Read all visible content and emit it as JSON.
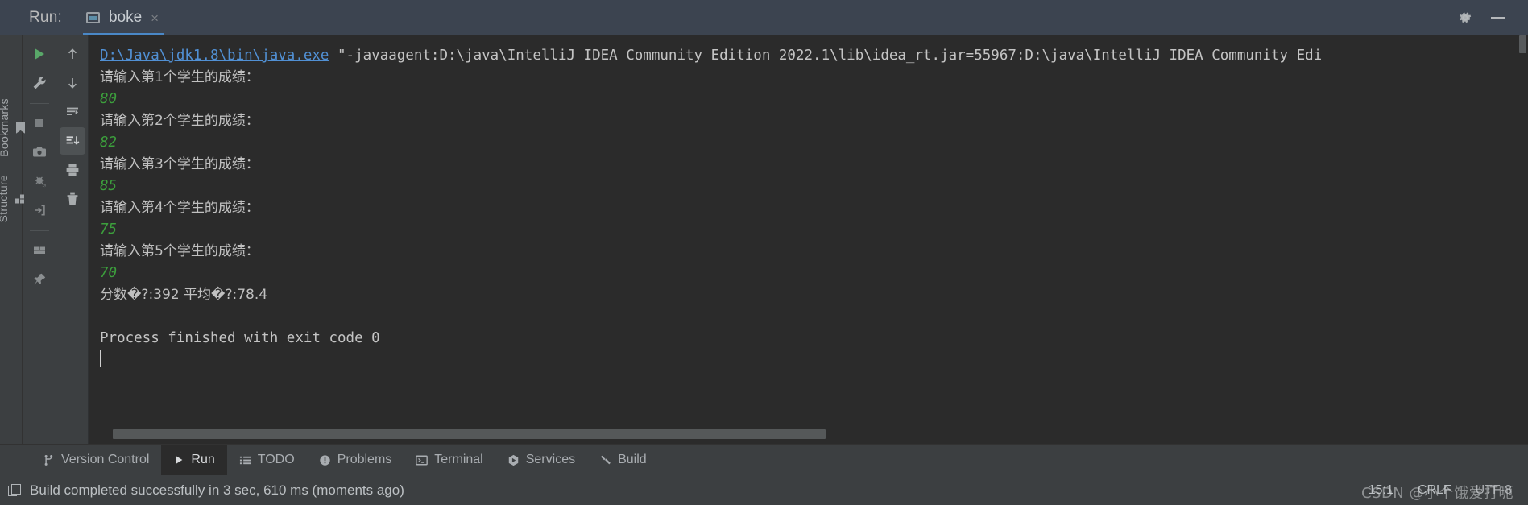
{
  "header": {
    "run_label": "Run:",
    "tab": {
      "title": "boke",
      "close": "×",
      "icon": "run-config-icon"
    },
    "settings_icon": "gear-icon",
    "minimize_icon": "minimize-icon"
  },
  "left_strip": {
    "items": [
      {
        "label": "Bookmarks",
        "icon": "bookmark-icon"
      },
      {
        "label": "Structure",
        "icon": "structure-icon"
      }
    ]
  },
  "run_toolbar": {
    "column_a": [
      {
        "name": "rerun-button",
        "icon": "play-icon",
        "tooltip": "Rerun"
      },
      {
        "name": "modify-run-configuration-button",
        "icon": "wrench-icon",
        "tooltip": "Modify Run Configuration"
      },
      {
        "name": "stop-button",
        "icon": "stop-icon",
        "tooltip": "Stop"
      },
      {
        "name": "screenshot-button",
        "icon": "camera-icon",
        "tooltip": "Take Screenshot"
      },
      {
        "name": "dump-threads-button",
        "icon": "bug-export-icon",
        "tooltip": "Dump Threads"
      },
      {
        "name": "restore-layout-button",
        "icon": "export-icon",
        "tooltip": "Restore Layout"
      },
      {
        "name": "layout-settings-button",
        "icon": "layout-icon",
        "tooltip": "Layout Settings"
      },
      {
        "name": "pin-tab-button",
        "icon": "pin-icon",
        "tooltip": "Pin Tab"
      }
    ],
    "column_b": [
      {
        "name": "up-the-stack-trace-button",
        "icon": "arrow-up-icon",
        "tooltip": "Up the Stack Trace"
      },
      {
        "name": "down-the-stack-trace-button",
        "icon": "arrow-down-icon",
        "tooltip": "Down the Stack Trace"
      },
      {
        "name": "soft-wrap-button",
        "icon": "soft-wrap-icon",
        "tooltip": "Soft-Wrap"
      },
      {
        "name": "scroll-to-end-button",
        "icon": "scroll-to-end-icon",
        "tooltip": "Scroll to the end",
        "active": true
      },
      {
        "name": "print-button",
        "icon": "print-icon",
        "tooltip": "Print"
      },
      {
        "name": "clear-all-button",
        "icon": "trash-icon",
        "tooltip": "Clear All"
      }
    ]
  },
  "console": {
    "command": {
      "path": "D:\\Java\\jdk1.8\\bin\\java.exe",
      "args": " \"-javaagent:D:\\java\\IntelliJ IDEA Community Edition 2022.1\\lib\\idea_rt.jar=55967:D:\\java\\IntelliJ IDEA Community Edi"
    },
    "lines": [
      {
        "type": "prompt",
        "text": "请输入第1个学生的成绩："
      },
      {
        "type": "input",
        "text": "80"
      },
      {
        "type": "prompt",
        "text": "请输入第2个学生的成绩："
      },
      {
        "type": "input",
        "text": "82"
      },
      {
        "type": "prompt",
        "text": "请输入第3个学生的成绩："
      },
      {
        "type": "input",
        "text": "85"
      },
      {
        "type": "prompt",
        "text": "请输入第4个学生的成绩："
      },
      {
        "type": "input",
        "text": "75"
      },
      {
        "type": "prompt",
        "text": "请输入第5个学生的成绩："
      },
      {
        "type": "input",
        "text": "70"
      },
      {
        "type": "result",
        "text": "分数�?:392  平均�?:78.4"
      },
      {
        "type": "blank",
        "text": ""
      },
      {
        "type": "exit",
        "text": "Process finished with exit code 0"
      }
    ]
  },
  "bottom_tabs": [
    {
      "label": "Version Control",
      "icon": "branch-icon",
      "selected": false
    },
    {
      "label": "Run",
      "icon": "play-icon",
      "selected": true
    },
    {
      "label": "TODO",
      "icon": "list-icon",
      "selected": false
    },
    {
      "label": "Problems",
      "icon": "warning-circle-icon",
      "selected": false
    },
    {
      "label": "Terminal",
      "icon": "terminal-icon",
      "selected": false
    },
    {
      "label": "Services",
      "icon": "services-icon",
      "selected": false
    },
    {
      "label": "Build",
      "icon": "hammer-icon",
      "selected": false
    }
  ],
  "status_bar": {
    "build_icon": "build-stack-icon",
    "build_message": "Build completed successfully in 3 sec, 610 ms (moments ago)",
    "caret_position": "15:1",
    "line_separator": "CRLF",
    "encoding": "UTF-8",
    "watermark": "CSDN @小个饿爱打呃"
  },
  "colors": {
    "console_bg": "#2b2b2b",
    "panel_bg": "#3c3f41",
    "header_bg": "#3c4450",
    "link": "#5190d4",
    "input_green": "#3c9f3c",
    "text": "#bbbbbb",
    "accent": "#4a88c7"
  }
}
